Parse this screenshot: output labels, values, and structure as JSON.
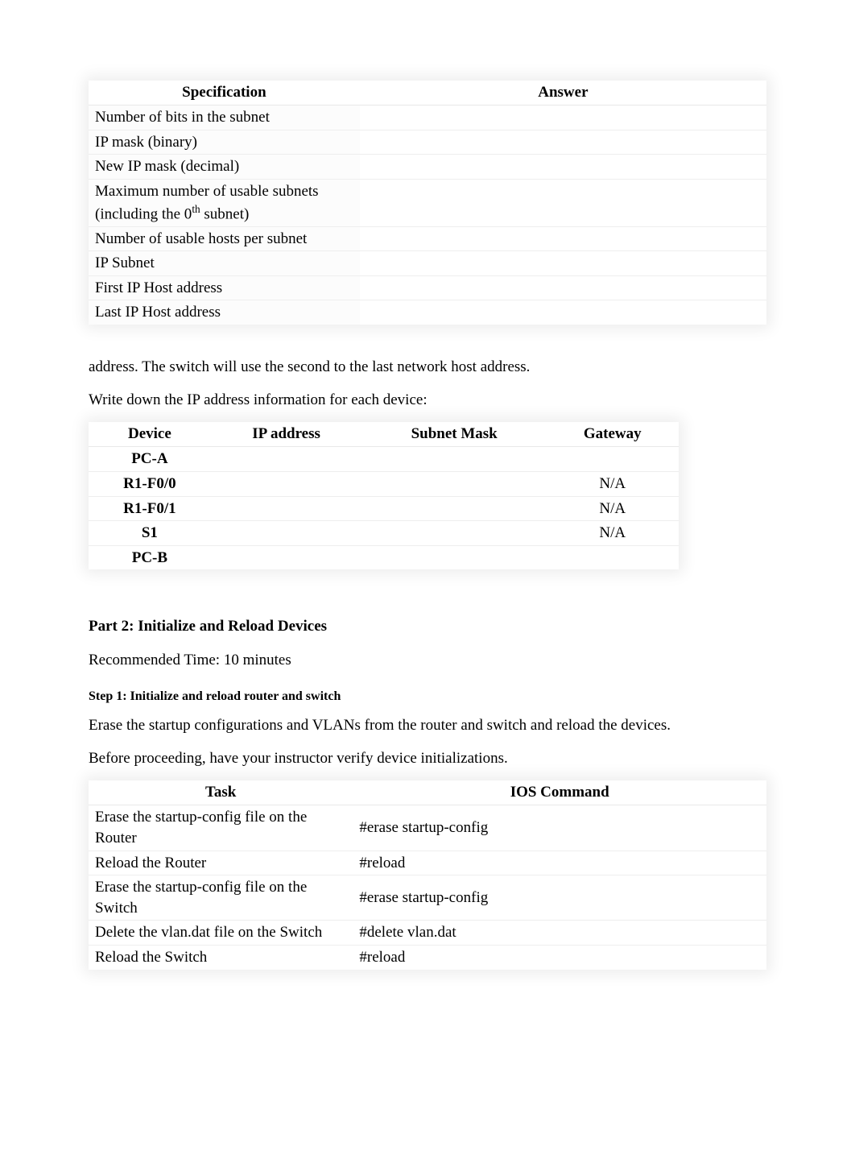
{
  "spec_table": {
    "headers": {
      "c1": "Specification",
      "c2": "Answer"
    },
    "rows": [
      {
        "label": "Number of bits in the subnet",
        "answer": ""
      },
      {
        "label": "IP mask (binary)",
        "answer": ""
      },
      {
        "label": "New IP mask (decimal)",
        "answer": ""
      },
      {
        "label_html": "Maximum number of usable subnets (including the 0<sup>th</sup> subnet)",
        "label": "Maximum number of usable subnets (including the 0th subnet)",
        "answer": ""
      },
      {
        "label": "Number of usable hosts per subnet",
        "answer": ""
      },
      {
        "label": "IP Subnet",
        "answer": ""
      },
      {
        "label": "First IP Host address",
        "answer": ""
      },
      {
        "label": "Last IP Host address",
        "answer": ""
      }
    ]
  },
  "paragraphs": {
    "p1": "address. The switch will use the second to the last network host address.",
    "p2": "Write down the IP address information for each device:"
  },
  "device_table": {
    "headers": {
      "c1": "Device",
      "c2": "IP address",
      "c3": "Subnet Mask",
      "c4": "Gateway"
    },
    "rows": [
      {
        "device": "PC-A",
        "ip": "",
        "mask": "",
        "gateway": ""
      },
      {
        "device": "R1-F0/0",
        "ip": "",
        "mask": "",
        "gateway": "N/A"
      },
      {
        "device": "R1-F0/1",
        "ip": "",
        "mask": "",
        "gateway": "N/A"
      },
      {
        "device": "S1",
        "ip": "",
        "mask": "",
        "gateway": "N/A"
      },
      {
        "device": "PC-B",
        "ip": "",
        "mask": "",
        "gateway": ""
      }
    ]
  },
  "part2": {
    "heading": "Part 2: Initialize and Reload Devices",
    "time": "Recommended Time: 10 minutes",
    "step1": "Step 1: Initialize and reload router and switch",
    "p1": "Erase the startup configurations and VLANs from the router and switch and reload the devices.",
    "p2": "Before proceeding, have your instructor verify device initializations."
  },
  "ios_table": {
    "headers": {
      "c1": "Task",
      "c2": "IOS Command"
    },
    "rows": [
      {
        "task": "Erase the startup-config file on the Router",
        "cmd": "#erase startup-config"
      },
      {
        "task": "Reload the Router",
        "cmd": "#reload"
      },
      {
        "task": "Erase the startup-config file on the Switch",
        "cmd": "#erase startup-config"
      },
      {
        "task": "Delete the vlan.dat file on the Switch",
        "cmd": "#delete vlan.dat"
      },
      {
        "task": "Reload the Switch",
        "cmd": "#reload"
      }
    ]
  }
}
